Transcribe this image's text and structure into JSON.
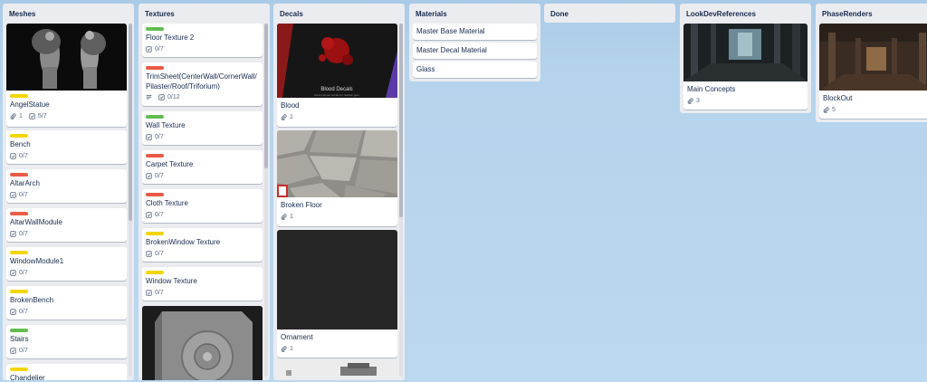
{
  "colors": {
    "green": "#61bd4f",
    "red": "#eb5a46",
    "yellow": "#f2d600"
  },
  "lists": {
    "meshes": {
      "title": "Meshes",
      "cards": [
        {
          "label": "yellow",
          "title": "AngelStatue",
          "attachments": "1",
          "checklist": "5/7"
        },
        {
          "label": "yellow",
          "title": "Bench",
          "checklist": "0/7"
        },
        {
          "label": "red",
          "title": "AltarArch",
          "checklist": "0/7"
        },
        {
          "label": "red",
          "title": "AltarWallModule",
          "checklist": "0/7"
        },
        {
          "label": "yellow",
          "title": "WindowModule1",
          "checklist": "0/7"
        },
        {
          "label": "yellow",
          "title": "BrokenBench",
          "checklist": "0/7"
        },
        {
          "label": "green",
          "title": "Stairs",
          "checklist": "0/7"
        },
        {
          "label": "yellow",
          "title": "Chandelier"
        }
      ]
    },
    "textures": {
      "title": "Textures",
      "cards": [
        {
          "label": "green",
          "title": "Floor Texture 2",
          "checklist": "0/7"
        },
        {
          "label": "red",
          "title": "TrimSheet(CenterWall/CornerWall/Pilaster/Roof/Triforium)",
          "checklist": "0/12"
        },
        {
          "label": "green",
          "title": "Wall Texture",
          "checklist": "0/7"
        },
        {
          "label": "red",
          "title": "Carpet Texture",
          "checklist": "0/7"
        },
        {
          "label": "red",
          "title": "Cloth Texture",
          "checklist": "0/7"
        },
        {
          "label": "yellow",
          "title": "BrokenWindow Texture",
          "checklist": "0/7"
        },
        {
          "label": "yellow",
          "title": "Window Texture",
          "checklist": "0/7"
        }
      ]
    },
    "decals": {
      "title": "Decals",
      "cards": [
        {
          "title": "Blood",
          "attachments": "1",
          "cover_title": "Blood Decals",
          "cover_sub": "Hand-painted decals for realistic gore"
        },
        {
          "title": "Broken Floor",
          "attachments": "1"
        },
        {
          "title": "Ornament",
          "attachments": "1"
        }
      ]
    },
    "materials": {
      "title": "Materials",
      "cards": [
        {
          "title": "Master Base Material"
        },
        {
          "title": "Master Decal Material"
        },
        {
          "title": "Glass"
        }
      ]
    },
    "done": {
      "title": "Done"
    },
    "lookdev": {
      "title": "LookDevReferences",
      "cards": [
        {
          "title": "Main Concepts",
          "attachments": "3"
        }
      ]
    },
    "phase": {
      "title": "PhaseRenders",
      "cards": [
        {
          "title": "BlockOut",
          "attachments": "5"
        }
      ]
    }
  }
}
